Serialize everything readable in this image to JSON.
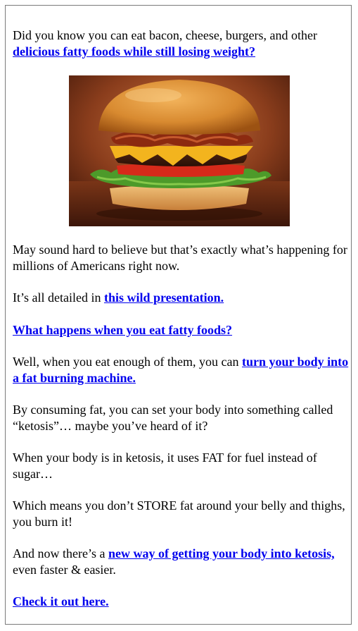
{
  "intro": {
    "text": "Did you know you can eat bacon, cheese, burgers, and other ",
    "link": "delicious fatty foods while still losing weight?"
  },
  "image": {
    "subject": "bacon cheeseburger photo"
  },
  "p2": {
    "text": "May sound hard to believe but that’s exactly what’s happening for millions of Americans right now."
  },
  "p3": {
    "text": "It’s all detailed in ",
    "link": "this wild presentation."
  },
  "p4": {
    "link": "What happens when you eat fatty foods?"
  },
  "p5": {
    "text": "Well, when you eat enough of them, you can ",
    "link": "turn your body into a fat burning machine."
  },
  "p6": {
    "text": "By consuming fat, you can set your body into something called “ketosis”… maybe you’ve heard of it?"
  },
  "p7": {
    "text": "When your body is in ketosis, it uses FAT for fuel instead of sugar…"
  },
  "p8": {
    "text": "Which means you don’t STORE fat around your belly and thighs, you burn it!"
  },
  "p9": {
    "text_before": "And now there’s a ",
    "link": "new way of getting your body into ketosis,",
    "text_after": " even faster & easier."
  },
  "p10": {
    "link": "Check it out here."
  }
}
